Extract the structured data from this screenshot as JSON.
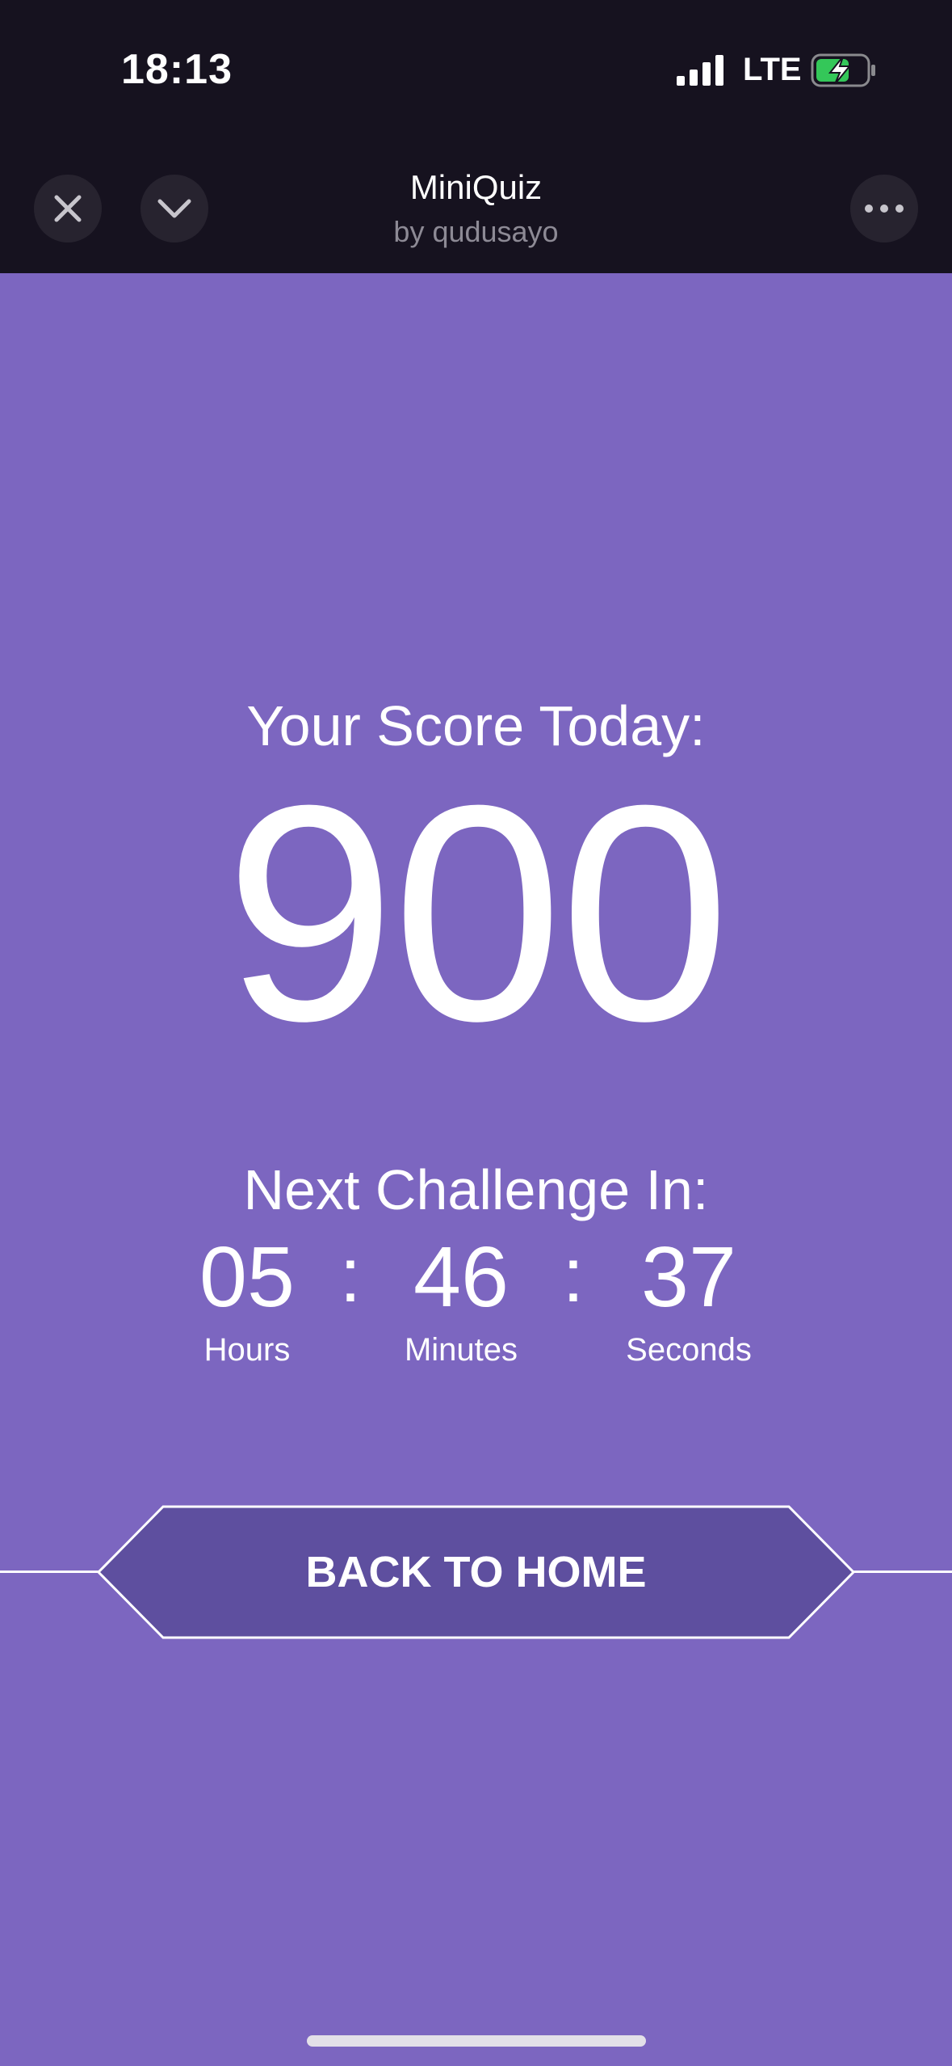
{
  "status_bar": {
    "time": "18:13",
    "network": "LTE",
    "icons": [
      "signal-icon",
      "battery-charging-icon"
    ],
    "battery_color": "#34c759"
  },
  "header": {
    "title": "MiniQuiz",
    "author": "by qudusayo",
    "icons": [
      "close-icon",
      "chevron-down-icon",
      "more-icon"
    ]
  },
  "score": {
    "label": "Your Score Today:",
    "value": "900"
  },
  "countdown": {
    "label": "Next Challenge In:",
    "hours": "05",
    "minutes": "46",
    "seconds": "37",
    "separator": ":",
    "hours_label": "Hours",
    "minutes_label": "Minutes",
    "seconds_label": "Seconds"
  },
  "actions": {
    "home_label": "BACK TO HOME"
  },
  "colors": {
    "background": "#7c66c0",
    "topbar": "#16121f",
    "button_fill": "#5e4f9f"
  }
}
